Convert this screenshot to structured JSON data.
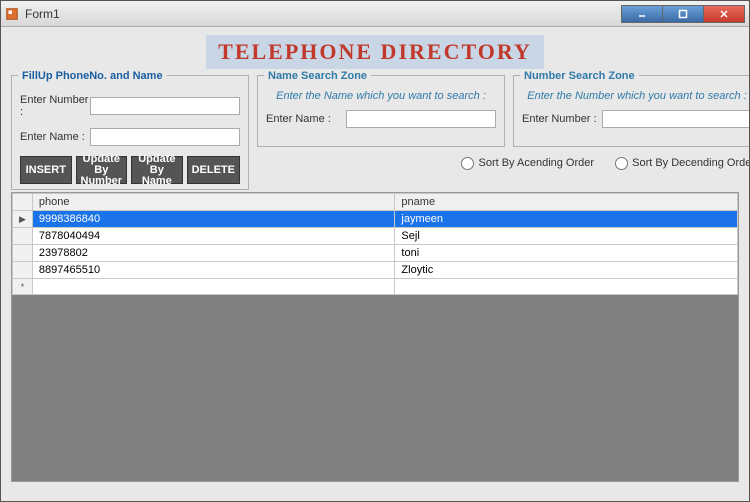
{
  "window": {
    "title": "Form1"
  },
  "banner": "TELEPHONE DIRECTORY",
  "fillup": {
    "legend": "FillUp PhoneNo. and Name",
    "number_label": "Enter Number :",
    "name_label": "Enter Name :",
    "number_value": "",
    "name_value": "",
    "btn_insert": "INSERT",
    "btn_update_number": "Update By Number",
    "btn_update_name": "Update By Name",
    "btn_delete": "DELETE"
  },
  "namesearch": {
    "legend": "Name Search Zone",
    "instruction": "Enter the Name which you want to search :",
    "label": "Enter Name :",
    "value": ""
  },
  "numbersearch": {
    "legend": "Number Search Zone",
    "instruction": "Enter the Number which you want to search :",
    "label": "Enter Number :",
    "value": ""
  },
  "sort": {
    "asc_label": "Sort By Acending Order",
    "desc_label": "Sort By Decending Order"
  },
  "grid": {
    "col_phone": "phone",
    "col_pname": "pname",
    "rows": [
      {
        "phone": "9998386840",
        "pname": "jaymeen",
        "selected": true,
        "marker": "▶"
      },
      {
        "phone": "7878040494",
        "pname": "Sejl",
        "selected": false,
        "marker": ""
      },
      {
        "phone": "23978802",
        "pname": "toni",
        "selected": false,
        "marker": ""
      },
      {
        "phone": "8897465510",
        "pname": "Zloytic",
        "selected": false,
        "marker": ""
      }
    ],
    "newrow_marker": "*"
  }
}
